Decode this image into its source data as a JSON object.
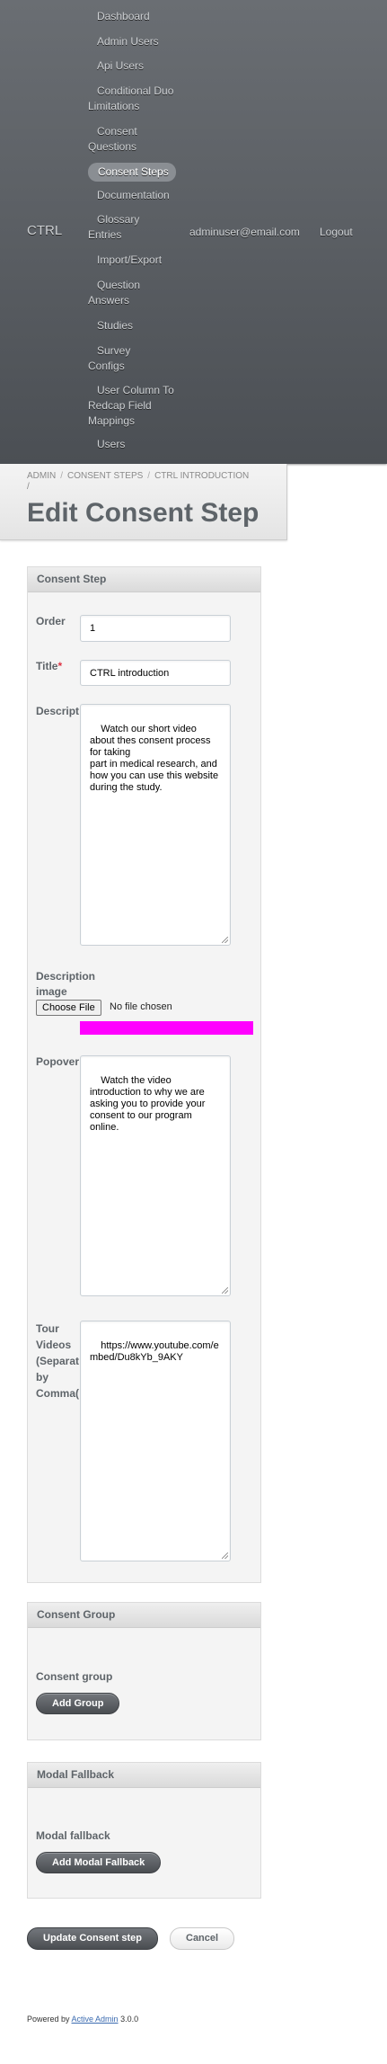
{
  "header": {
    "brand": "CTRL",
    "user_email": "adminuser@email.com",
    "logout": "Logout",
    "nav": [
      "Dashboard",
      "Admin Users",
      "Api Users",
      "Conditional Duo Limitations",
      "Consent Questions",
      "Consent Steps",
      "Documentation",
      "Glossary Entries",
      "Import/Export",
      "Question Answers",
      "Studies",
      "Survey Configs",
      "User Column To Redcap Field Mappings",
      "Users"
    ],
    "current_nav": "Consent Steps"
  },
  "breadcrumb": {
    "items": [
      "ADMIN",
      "CONSENT STEPS",
      "CTRL INTRODUCTION"
    ],
    "separator": "/"
  },
  "page_title": "Edit Consent Step",
  "form": {
    "consent_step": {
      "legend": "Consent Step",
      "order_label": "Order",
      "order_value": "1",
      "title_label": "Title",
      "required_marker": "*",
      "title_value": "CTRL introduction",
      "description_label": "Description",
      "description_value": "Watch our short video about thes consent process for taking\npart in medical research, and how you can use this website during the study.",
      "description_image_label": "Description image",
      "choose_file_label": "Choose File",
      "no_file_label": "No file chosen",
      "popover_label": "Popover",
      "popover_value": "Watch the video introduction to why we are asking you to provide your\nconsent to our program online.",
      "tour_videos_label": "Tour Videos (Separated by Comma(,))",
      "tour_videos_value": "https://www.youtube.com/embed/Du8kYb_9AKY"
    },
    "consent_group": {
      "legend": "Consent Group",
      "label": "Consent group",
      "add_button": "Add Group"
    },
    "modal_fallback": {
      "legend": "Modal Fallback",
      "label": "Modal fallback",
      "add_button": "Add Modal Fallback"
    },
    "submit_label": "Update Consent step",
    "cancel_label": "Cancel"
  },
  "footer": {
    "prefix": "Powered by ",
    "link": "Active Admin",
    "version": " 3.0.0"
  },
  "colors": {
    "header_top": "#6a6e73",
    "header_bottom": "#4b4f54",
    "highlight": "#ff00ff",
    "title_text": "#5e6469"
  }
}
